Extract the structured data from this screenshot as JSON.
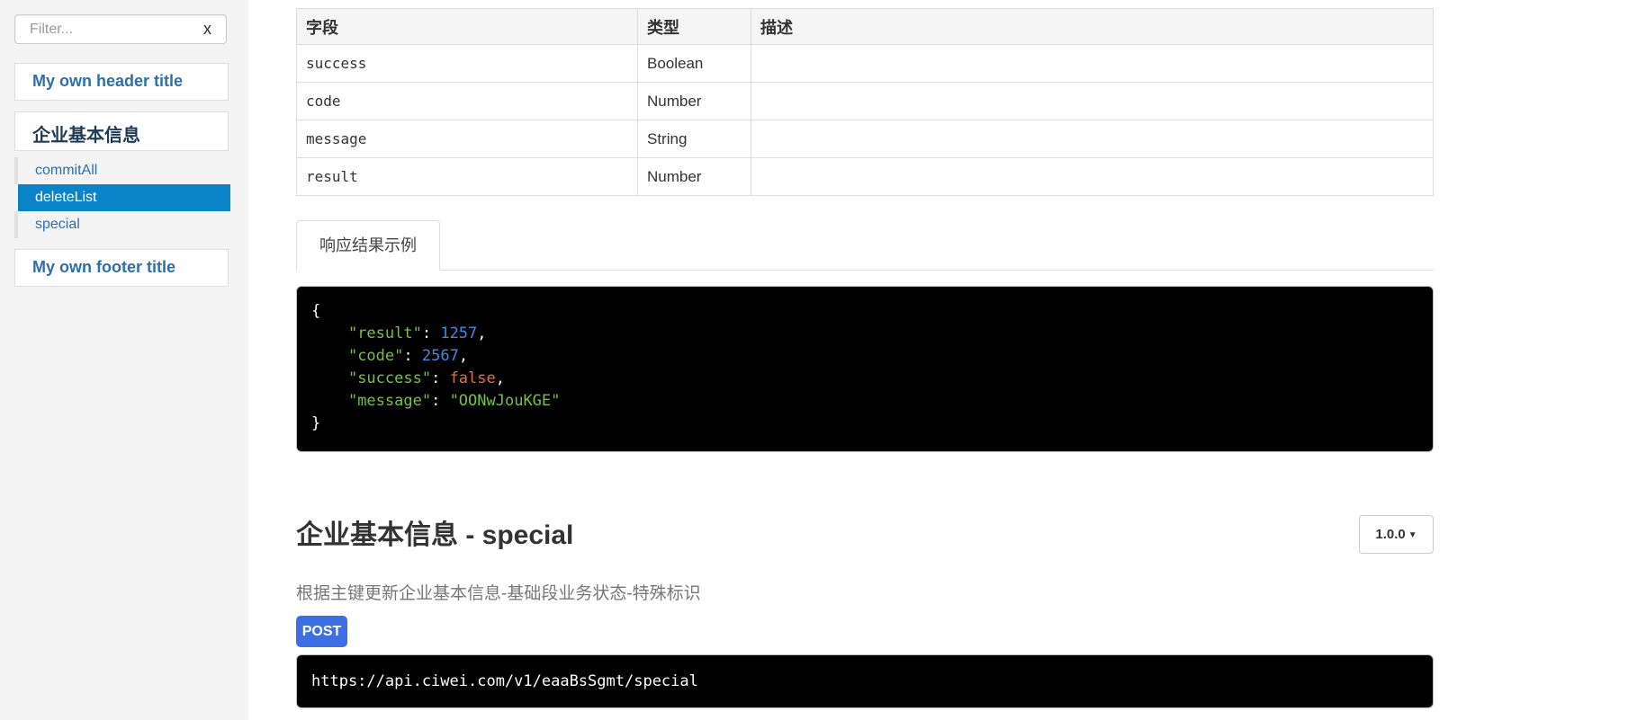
{
  "sidebar": {
    "filter": {
      "placeholder": "Filter...",
      "clear_label": "x"
    },
    "header_title": "My own header title",
    "group_title": "企业基本信息",
    "items": [
      {
        "label": "commitAll",
        "active": false
      },
      {
        "label": "deleteList",
        "active": true
      },
      {
        "label": "special",
        "active": false
      }
    ],
    "footer_title": "My own footer title"
  },
  "fields_table": {
    "headers": [
      "字段",
      "类型",
      "描述"
    ],
    "rows": [
      {
        "field": "success",
        "type": "Boolean",
        "desc": ""
      },
      {
        "field": "code",
        "type": "Number",
        "desc": ""
      },
      {
        "field": "message",
        "type": "String",
        "desc": ""
      },
      {
        "field": "result",
        "type": "Number",
        "desc": ""
      }
    ]
  },
  "response_tab": {
    "label": "响应结果示例"
  },
  "response_example": {
    "open": "{",
    "result_key": "\"result\"",
    "result_value": "1257",
    "code_key": "\"code\"",
    "code_value": "2567",
    "success_key": "\"success\"",
    "success_value": "false",
    "message_key": "\"message\"",
    "message_value": "\"OONwJouKGE\"",
    "close": "}"
  },
  "section": {
    "title": "企业基本信息 - special",
    "version": "1.0.0",
    "description": "根据主键更新企业基本信息-基础段业务状态-特殊标识",
    "method": "POST",
    "url": "https://api.ciwei.com/v1/eaaBsSgmt/special"
  },
  "colors": {
    "link": "#2f6ea8",
    "active_item": "#0a84c9",
    "post_badge": "#3b6fe3",
    "json_key": "#76c043",
    "json_number": "#3e8be0",
    "json_boolean": "#e0704a"
  }
}
